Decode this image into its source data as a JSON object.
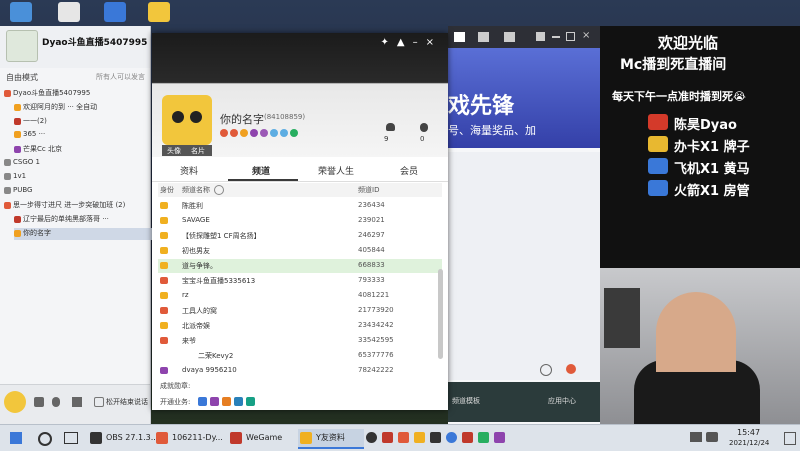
{
  "yy": {
    "channel_name": "Dyao斗鱼直播5407995",
    "mode": "自由模式",
    "mode_hint": "所有人可以发言",
    "tree": [
      {
        "label": "Dyao斗鱼直播5407995",
        "color": "#e05a3a"
      },
      {
        "label": "欢迎阿月的到 ··· 全自动",
        "color": "#f0a020"
      },
      {
        "label": "一一(2)",
        "color": "#c0392b"
      },
      {
        "label": "365 ···",
        "color": "#f0a020"
      },
      {
        "label": "芒果Cc 北京",
        "color": "#8e44ad"
      },
      {
        "label": "CSGO 1",
        "color": "#888"
      },
      {
        "label": "1v1",
        "color": "#888"
      },
      {
        "label": "PUBG",
        "color": "#888"
      },
      {
        "label": "思一步得寸进尺 进一步突破加班 (2)",
        "color": "#e05a3a"
      },
      {
        "label": "辽宁最后的单纯黑部落哥 ···",
        "color": "#c0392b"
      },
      {
        "label": "你的名字",
        "color": "#f0a020"
      }
    ],
    "bottom_text": "松开结束说话"
  },
  "profile": {
    "name": "你的名字",
    "id_text": "(84108859)",
    "avatar_tabs": [
      "头像",
      "名片"
    ],
    "likes": "9",
    "fans": "0",
    "tabs": [
      "资料",
      "频道",
      "荣誉人生",
      "会员"
    ],
    "table_headers": [
      "身份",
      "频道名称",
      "频道ID"
    ],
    "rows": [
      {
        "name": "陈胜利",
        "id": "236434",
        "color": "#f0b020",
        "hl": false
      },
      {
        "name": "SAVAGE",
        "id": "239021",
        "color": "#f0b020",
        "hl": false
      },
      {
        "name": "【侦探雕塑1 CF周名扬】",
        "id": "246297",
        "color": "#f0b020",
        "hl": false
      },
      {
        "name": "初也男友",
        "id": "405844",
        "color": "#f0b020",
        "hl": false
      },
      {
        "name": "道与争锋。",
        "id": "668833",
        "color": "#f0b020",
        "hl": true
      },
      {
        "name": "宝宝斗鱼直播5335613",
        "id": "793333",
        "color": "#e05a3a",
        "hl": false
      },
      {
        "name": "rz",
        "id": "4081221",
        "color": "#f0b020",
        "hl": false
      },
      {
        "name": "工具人的窝",
        "id": "21773920",
        "color": "#e05a3a",
        "hl": false
      },
      {
        "name": "北派帝娱",
        "id": "23434242",
        "color": "#f0b020",
        "hl": false
      },
      {
        "name": "来爷",
        "id": "33542595",
        "color": "#e05a3a",
        "hl": false
      },
      {
        "name": "二荣Kevy2",
        "id": "65377776",
        "color": "#ffffff",
        "hl": false
      },
      {
        "name": "dvaya 9956210",
        "id": "78242222",
        "color": "#8e44ad",
        "hl": false
      }
    ],
    "footer_achievements": "成就勋章:",
    "footer_services": "开通业务:"
  },
  "site": {
    "banner": "戏先锋",
    "sub": "号、海量奖品、加",
    "bottom_items": [
      "频道模板",
      "应用中心"
    ]
  },
  "overlay": {
    "line1": "欢迎光临",
    "line2": "Mc播到死直播间",
    "line3": "每天下午一点准时播到死😭",
    "entries": [
      {
        "label": "陈昊Dyao",
        "color": "#d43a2a"
      },
      {
        "label": "办卡X1 牌子",
        "color": "#e8b830"
      },
      {
        "label": "飞机X1 黄马",
        "color": "#3a78d8"
      },
      {
        "label": "火箭X1 房管",
        "color": "#3a78d8"
      }
    ]
  },
  "taskbar": {
    "items": [
      {
        "label": "OBS 27.1.3...",
        "color": "#333"
      },
      {
        "label": "106211-Dy...",
        "color": "#e05a3a"
      },
      {
        "label": "WeGame",
        "color": "#c0392b"
      },
      {
        "label": "Y友资料",
        "color": "#f0b020"
      }
    ],
    "time": "15:47",
    "date": "2021/12/24"
  }
}
